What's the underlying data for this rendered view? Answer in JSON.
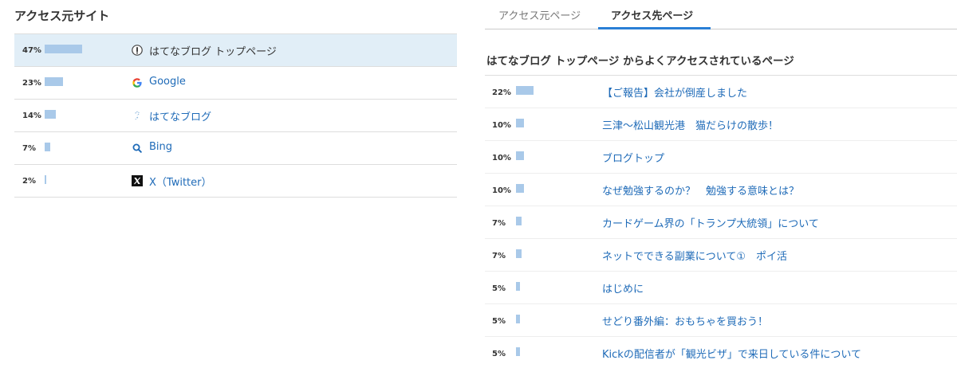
{
  "left": {
    "title": "アクセス元サイト",
    "rows": [
      {
        "percent": "47%",
        "value": 47,
        "label": "はてなブログ トップページ",
        "icon": "hatena-badge-icon",
        "selected": true
      },
      {
        "percent": "23%",
        "value": 23,
        "label": "Google",
        "icon": "google-icon",
        "selected": false
      },
      {
        "percent": "14%",
        "value": 14,
        "label": "はてなブログ",
        "icon": "hatena-blog-icon",
        "selected": false
      },
      {
        "percent": "7%",
        "value": 7,
        "label": "Bing",
        "icon": "bing-search-icon",
        "selected": false
      },
      {
        "percent": "2%",
        "value": 2,
        "label": "X（Twitter）",
        "icon": "x-twitter-icon",
        "selected": false
      }
    ]
  },
  "right": {
    "tabs": [
      {
        "label": "アクセス元ページ",
        "active": false
      },
      {
        "label": "アクセス先ページ",
        "active": true
      }
    ],
    "heading": "はてなブログ トップページ からよくアクセスされているページ",
    "rows": [
      {
        "percent": "22%",
        "value": 22,
        "label": "【ご報告】会社が倒産しました"
      },
      {
        "percent": "10%",
        "value": 10,
        "label": "三津～松山観光港　猫だらけの散歩！"
      },
      {
        "percent": "10%",
        "value": 10,
        "label": "ブログトップ"
      },
      {
        "percent": "10%",
        "value": 10,
        "label": "なぜ勉強するのか？　勉強する意味とは？"
      },
      {
        "percent": "7%",
        "value": 7,
        "label": "カードゲーム界の「トランプ大統領」について"
      },
      {
        "percent": "7%",
        "value": 7,
        "label": "ネットでできる副業について①　ポイ活"
      },
      {
        "percent": "5%",
        "value": 5,
        "label": "はじめに"
      },
      {
        "percent": "5%",
        "value": 5,
        "label": "せどり番外編：おもちゃを買おう！"
      },
      {
        "percent": "5%",
        "value": 5,
        "label": "Kickの配信者が「観光ビザ」で来日している件について"
      }
    ]
  },
  "colors": {
    "bar": "#a9c9e9",
    "link": "#1f6bb8",
    "selected_row": "#e1eef7",
    "tab_underline": "#2a7fd6"
  }
}
